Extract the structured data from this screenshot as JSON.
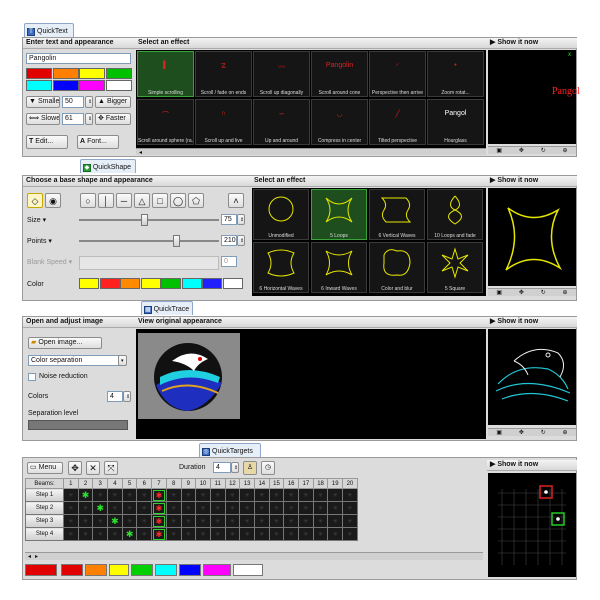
{
  "quicktext": {
    "tab": "QuickText",
    "enter_header": "Enter text and appearance",
    "text_value": "Pangolin",
    "swatches": [
      "#e00000",
      "#ff7f00",
      "#ffff00",
      "#00c000",
      "#00ffff",
      "#0000ff",
      "#ff00ff",
      "#ffffff"
    ],
    "smaller": "Smaller",
    "smaller_value": "50",
    "bigger": "Bigger",
    "slower": "Slower",
    "slower_value": "61",
    "faster": "Faster",
    "edit": "Edit...",
    "font": "Font...",
    "effect_header": "Select an effect",
    "effects": [
      "Simple scrolling",
      "Scroll / fade on ends",
      "Scroll up diagonally",
      "Scroll around cone",
      "Perspective then arrive",
      "Zoom rotat...",
      "Scroll around sphere (ra...",
      "Scroll up and live",
      "Up and around",
      "Compress in center",
      "Tilted perspective",
      "Hourglass"
    ],
    "show_header": "Show it now",
    "preview_text": "Pangol"
  },
  "quickshape": {
    "tab": "QuickShape",
    "base_header": "Choose a base shape and appearance",
    "size_label": "Size",
    "size_value": "75",
    "points_label": "Points",
    "points_value": "210",
    "blank_label": "Blank Speed",
    "blank_value": "0",
    "color_label": "Color",
    "swatches": [
      "#ffff00",
      "#ff2020",
      "#ff8a00",
      "#ffff00",
      "#00c000",
      "#00ffff",
      "#2020ff",
      "#ffffff"
    ],
    "effect_header": "Select an effect",
    "effects": [
      "Unmodified",
      "5 Loops",
      "6 Vertical Waves",
      "10 Loops and fade",
      "6 Horizontal Waves",
      "6 Inward Waves",
      "Color and blur",
      "5 Square"
    ],
    "show_header": "Show it now"
  },
  "quicktrace": {
    "tab": "QuickTrace",
    "open_header": "Open and adjust image",
    "open_image": "Open image...",
    "mode": "Color separation",
    "noise": "Noise reduction",
    "colors_label": "Colors",
    "colors_value": "4",
    "sep_label": "Separation level",
    "view_header": "View original appearance",
    "show_header": "Show it now"
  },
  "quicktargets": {
    "tab": "QuickTargets",
    "menu": "Menu",
    "duration_label": "Duration",
    "duration_value": "4",
    "beams_label": "Beams:",
    "columns": [
      "1",
      "2",
      "3",
      "4",
      "5",
      "6",
      "7",
      "8",
      "9",
      "10",
      "11",
      "12",
      "13",
      "14",
      "15",
      "16",
      "17",
      "18",
      "19",
      "20"
    ],
    "steps": [
      "Step 1",
      "Step 2",
      "Step 3",
      "Step 4"
    ],
    "active": [
      [
        2,
        7
      ],
      [
        3,
        7
      ],
      [
        4,
        7
      ],
      [
        5,
        7
      ]
    ],
    "show_header": "Show it now",
    "palette": [
      "#e00000",
      "#e00000",
      "#ff7f00",
      "#ffff00",
      "#00d000",
      "#00ffff",
      "#0000ff",
      "#ff00ff",
      "#ffffff"
    ]
  }
}
